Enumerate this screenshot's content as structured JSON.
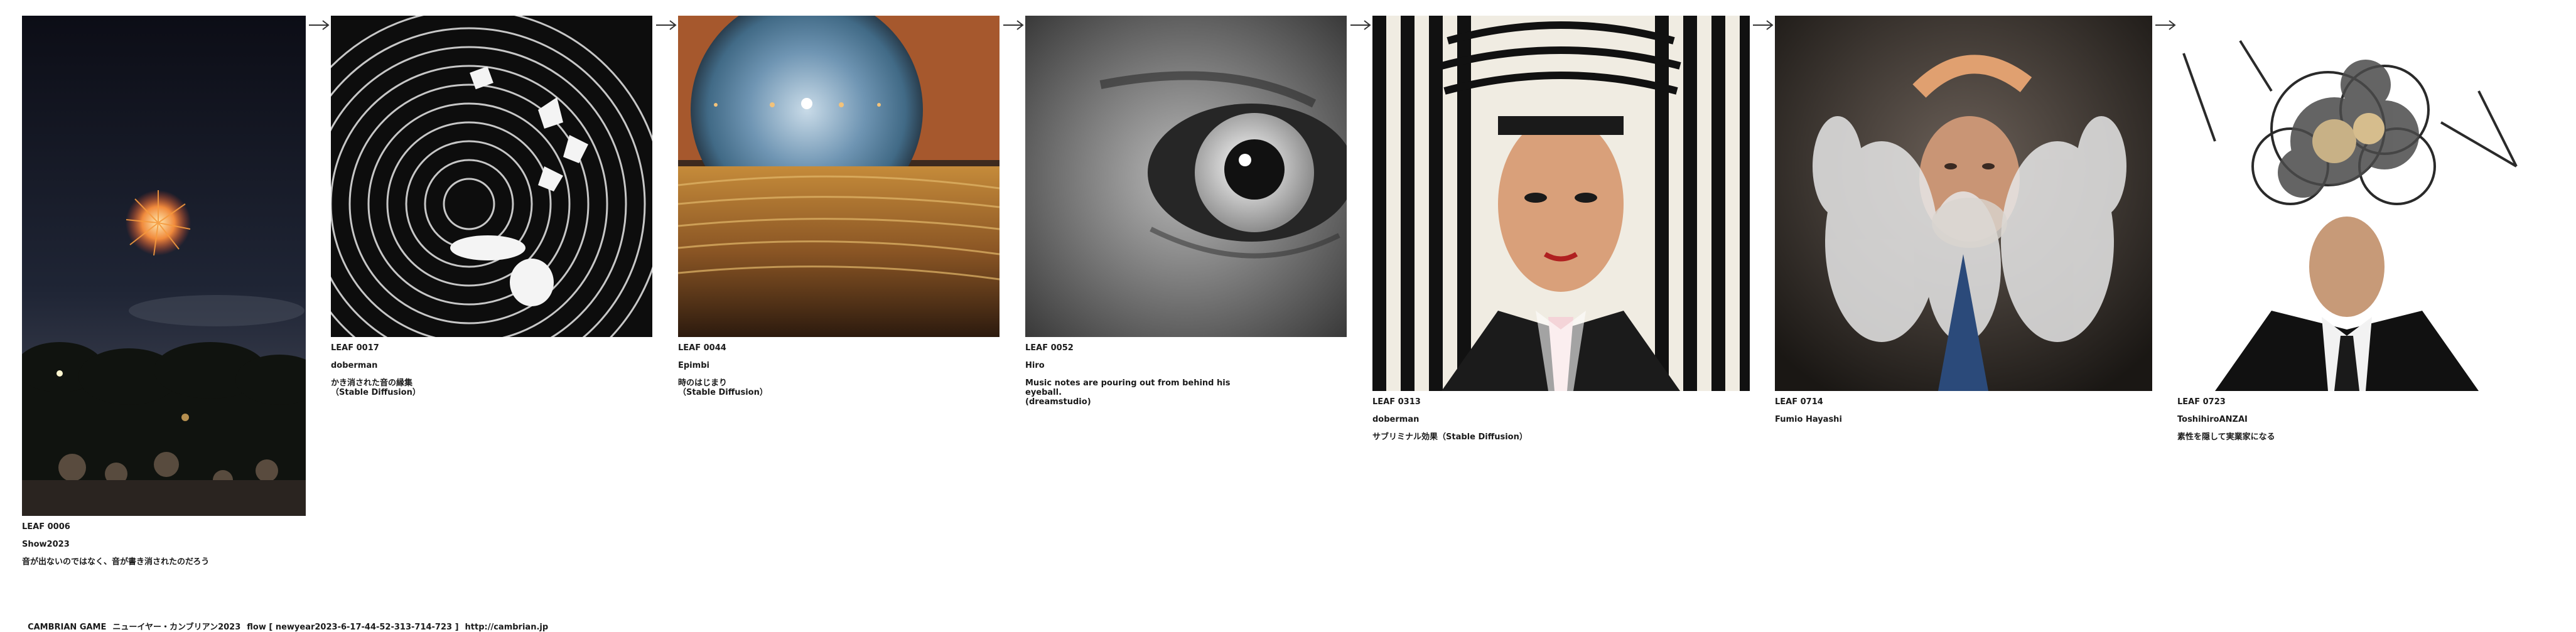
{
  "leaves": [
    {
      "id": "LEAF 0006",
      "author": "Show2023",
      "desc": "音が出ないのではなく、音が書き消されたのだろう",
      "image": "fireworks-photo"
    },
    {
      "id": "LEAF 0017",
      "author": "doberman",
      "desc": "かき消された音の縁集\n（Stable Diffusion）",
      "image": "swirl-ink-drawing"
    },
    {
      "id": "LEAF 0044",
      "author": "Epimbi",
      "desc": "時のはじまり\n（Stable Diffusion）",
      "image": "cosmic-eye-landscape"
    },
    {
      "id": "LEAF 0052",
      "author": "Hiro",
      "desc": "Music notes are pouring out from behind his eyeball.\n(dreamstudio)",
      "image": "grayscale-eye"
    },
    {
      "id": "LEAF 0313",
      "author": "doberman",
      "desc": "サブリミナル効果（Stable Diffusion）",
      "image": "striped-portrait"
    },
    {
      "id": "LEAF 0714",
      "author": "Fumio Hayashi",
      "desc": "",
      "image": "exploding-man-portrait"
    },
    {
      "id": "LEAF 0723",
      "author": "ToshihiroANZAI",
      "desc": "素性を隠して実業家になる",
      "image": "clockwork-head"
    }
  ],
  "footer": {
    "brand": "CAMBRIAN GAME",
    "title": "ニューイヤー・カンブリアン2023",
    "flow": "flow [ newyear2023-6-17-44-52-313-714-723 ]",
    "url": "http://cambrian.jp"
  }
}
